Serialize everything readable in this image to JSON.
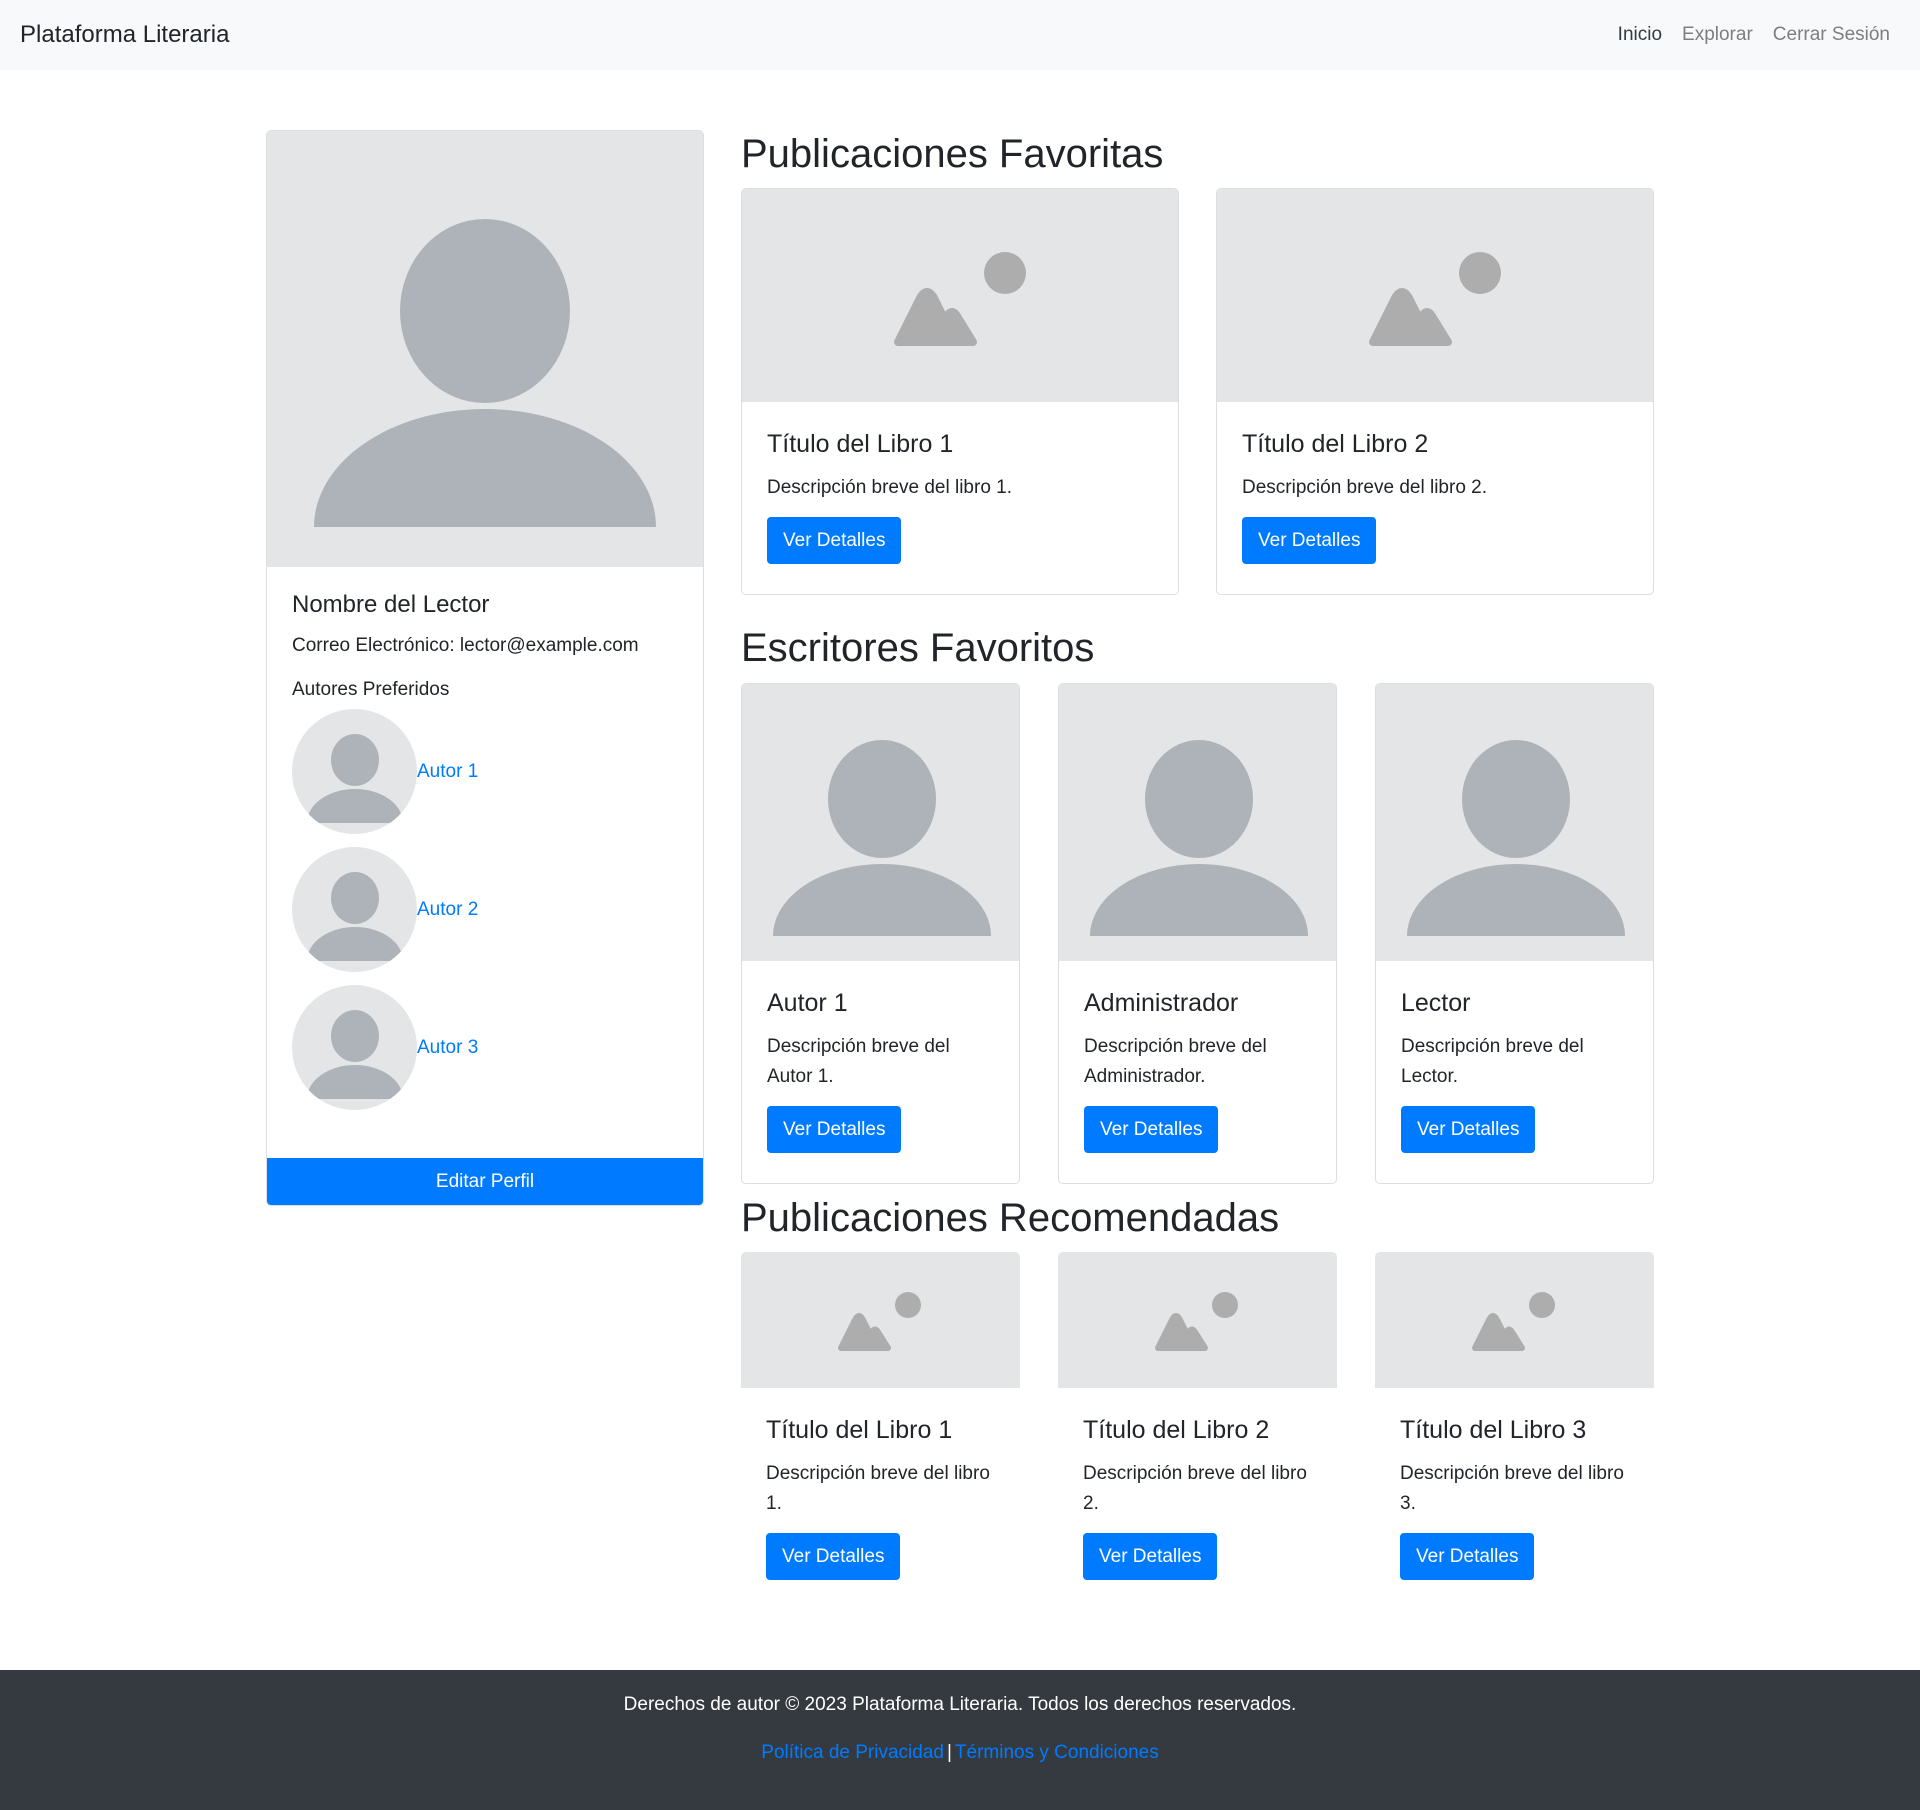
{
  "navbar": {
    "brand": "Plataforma Literaria",
    "links": [
      "Inicio",
      "Explorar",
      "Cerrar Sesión"
    ]
  },
  "profile": {
    "name": "Nombre del Lector",
    "email": "Correo Electrónico: lector@example.com",
    "authors_title": "Autores Preferidos",
    "authors": [
      "Autor 1",
      "Autor 2",
      "Autor 3"
    ],
    "edit_label": "Editar Perfil"
  },
  "favorites": {
    "title": "Publicaciones Favoritas",
    "items": [
      {
        "title": "Título del Libro 1",
        "desc": "Descripción breve del libro 1.",
        "button": "Ver Detalles"
      },
      {
        "title": "Título del Libro 2",
        "desc": "Descripción breve del libro 2.",
        "button": "Ver Detalles"
      }
    ]
  },
  "writers": {
    "title": "Escritores Favoritos",
    "items": [
      {
        "title": "Autor 1",
        "desc": "Descripción breve del Autor 1.",
        "button": "Ver Detalles"
      },
      {
        "title": "Administrador",
        "desc": "Descripción breve del Administrador.",
        "button": "Ver Detalles"
      },
      {
        "title": "Lector",
        "desc": "Descripción breve del Lector.",
        "button": "Ver Detalles"
      }
    ]
  },
  "recommended": {
    "title": "Publicaciones Recomendadas",
    "items": [
      {
        "title": "Título del Libro 1",
        "desc": "Descripción breve del libro 1.",
        "button": "Ver Detalles"
      },
      {
        "title": "Título del Libro 2",
        "desc": "Descripción breve del libro 2.",
        "button": "Ver Detalles"
      },
      {
        "title": "Título del Libro 3",
        "desc": "Descripción breve del libro 3.",
        "button": "Ver Detalles"
      }
    ]
  },
  "footer": {
    "copyright": "Derechos de autor © 2023 Plataforma Literaria. Todos los derechos reservados.",
    "privacy": "Política de Privacidad",
    "separator": "|",
    "terms": "Términos y Condiciones"
  },
  "colors": {
    "primary": "#007bff",
    "navbar_bg": "#f8f9fa",
    "footer_bg": "#343a40",
    "placeholder_bg": "#e3e5e7",
    "placeholder_fg": "#adb3b8"
  },
  "icons": {
    "profile_placeholder": "person-silhouette-icon",
    "image_placeholder": "image-landscape-icon"
  }
}
